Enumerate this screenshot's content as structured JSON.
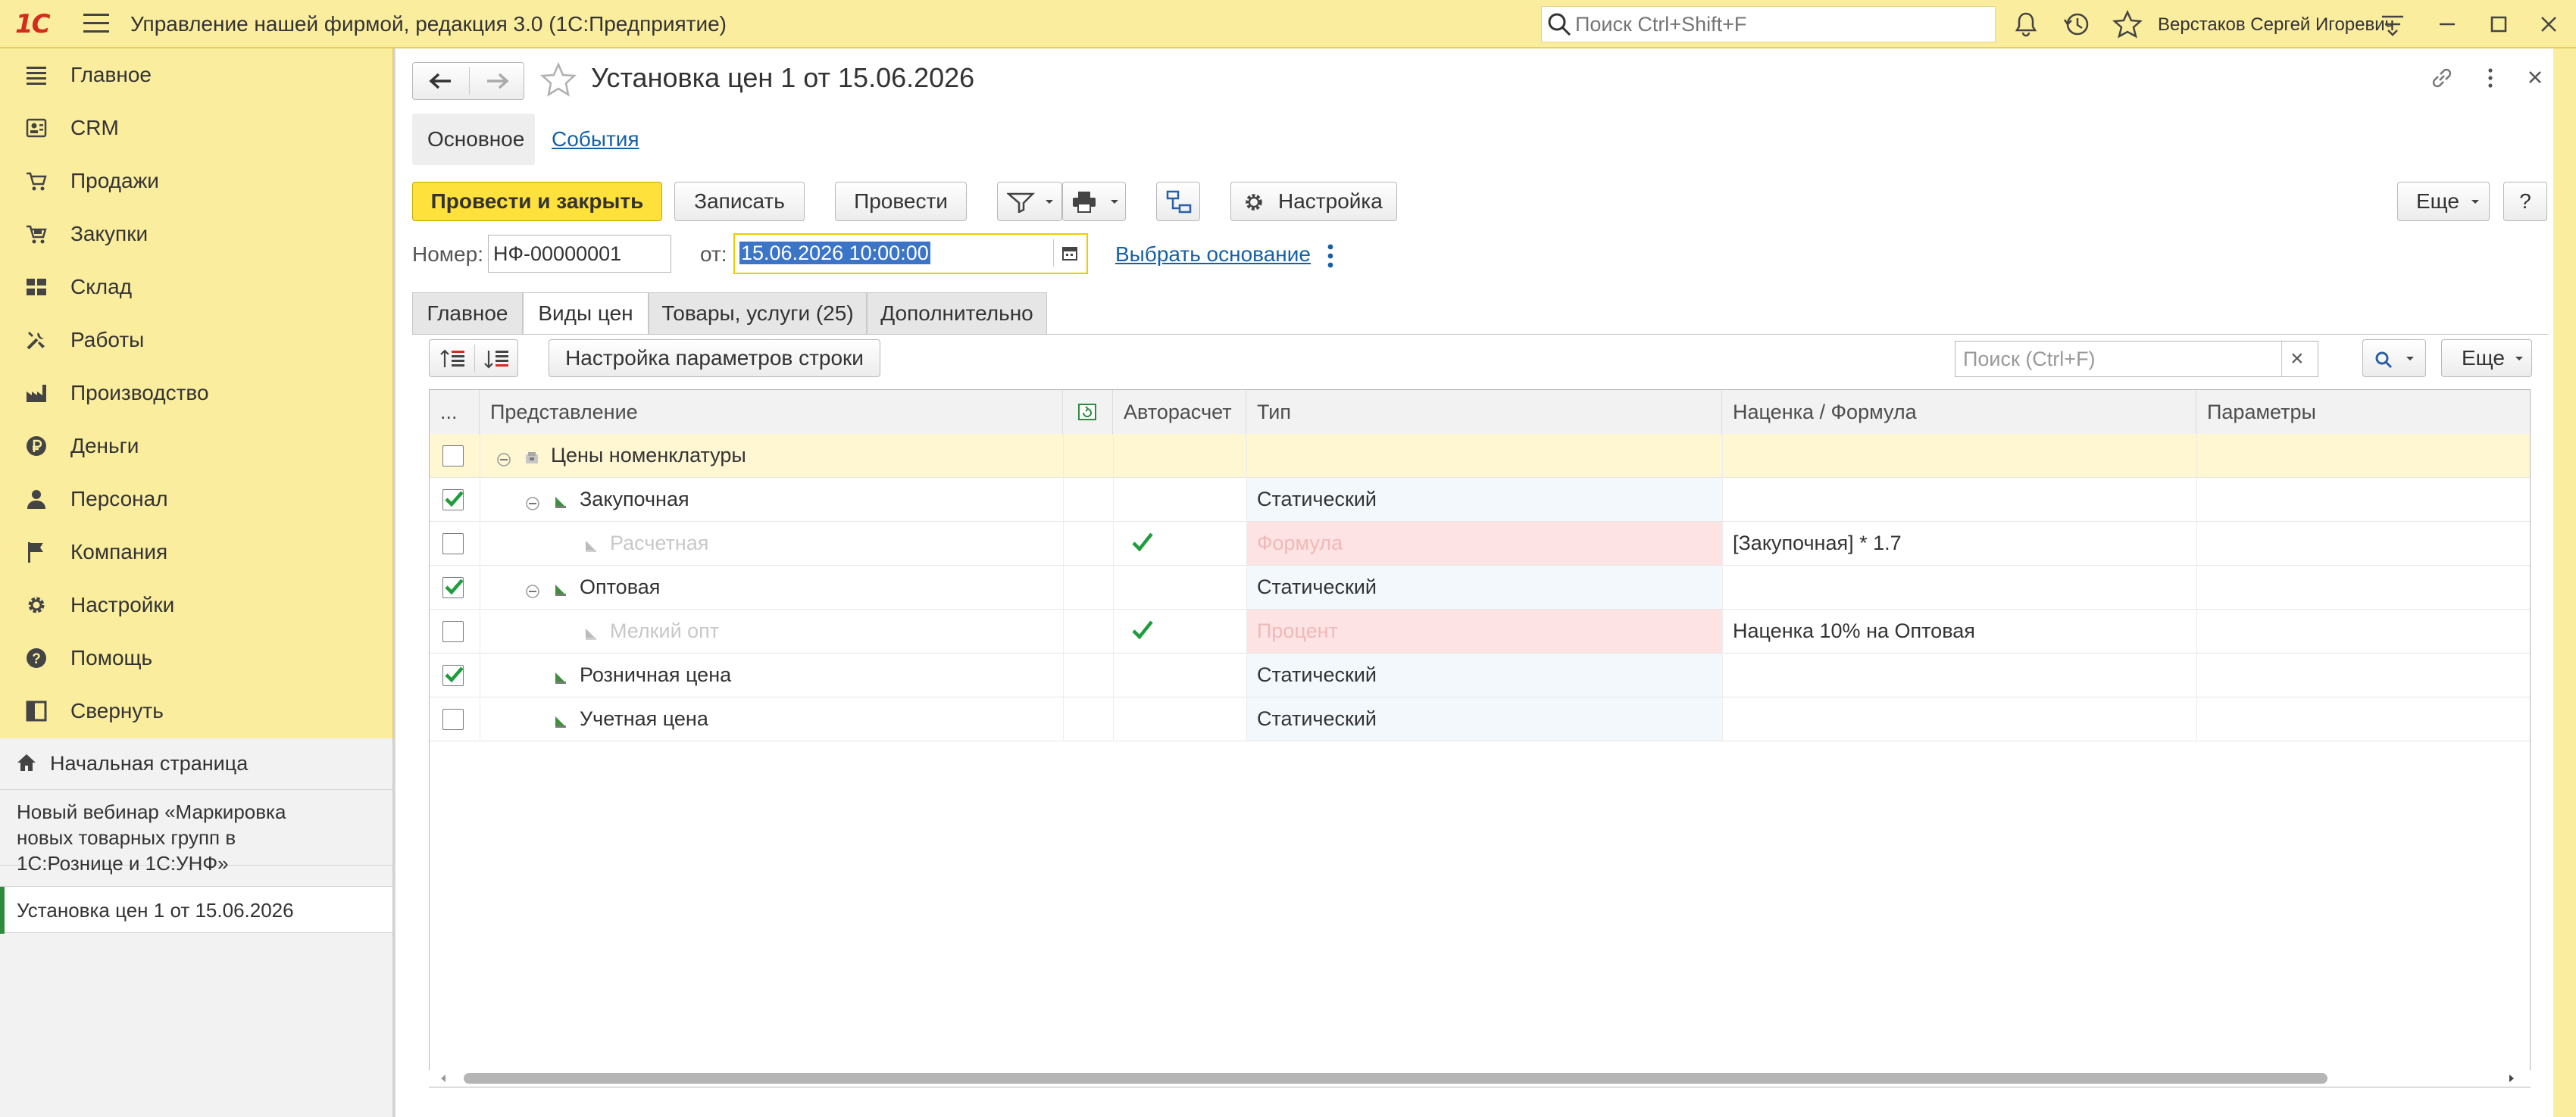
{
  "app": {
    "logo": "1С",
    "title": "Управление нашей фирмой, редакция 3.0  (1С:Предприятие)",
    "search_placeholder": "Поиск Ctrl+Shift+F",
    "user": "Верстаков Сергей Игоревич"
  },
  "sidebar": {
    "items": [
      {
        "label": "Главное",
        "icon": "menu-lines-icon"
      },
      {
        "label": "CRM",
        "icon": "contacts-icon"
      },
      {
        "label": "Продажи",
        "icon": "sales-cart-icon"
      },
      {
        "label": "Закупки",
        "icon": "purchases-icon"
      },
      {
        "label": "Склад",
        "icon": "warehouse-grid-icon"
      },
      {
        "label": "Работы",
        "icon": "tools-icon"
      },
      {
        "label": "Производство",
        "icon": "factory-icon"
      },
      {
        "label": "Деньги",
        "icon": "ruble-icon"
      },
      {
        "label": "Персонал",
        "icon": "person-icon"
      },
      {
        "label": "Компания",
        "icon": "flag-icon"
      },
      {
        "label": "Настройки",
        "icon": "gear-icon"
      },
      {
        "label": "Помощь",
        "icon": "help-icon"
      },
      {
        "label": "Свернуть",
        "icon": "collapse-panel-icon"
      }
    ],
    "home": "Начальная страница",
    "webinar": [
      "Новый вебинар «Маркировка",
      "новых товарных групп в",
      "1С:Рознице и 1С:УНФ»"
    ],
    "current_doc": "Установка цен 1 от 15.06.2026"
  },
  "document": {
    "title": "Установка цен 1 от 15.06.2026",
    "nav_tabs": {
      "main": "Основное",
      "events": "События"
    },
    "toolbar": {
      "post_close": "Провести и закрыть",
      "save": "Записать",
      "post": "Провести",
      "settings": "Настройка",
      "more": "Еще",
      "help": "?"
    },
    "number_label": "Номер:",
    "number_value": "НФ-00000001",
    "date_label": "от:",
    "date_value": "15.06.2026 10:00:00",
    "select_basis": "Выбрать основание",
    "tabs": [
      "Главное",
      "Виды цен",
      "Товары, услуги (25)",
      "Дополнительно"
    ],
    "table_toolbar": {
      "row_settings": "Настройка параметров строки",
      "search_placeholder": "Поиск (Ctrl+F)",
      "clear": "×",
      "more": "Еще"
    }
  },
  "table": {
    "columns": {
      "mark": "...",
      "name": "Представление",
      "auto": "Авторасчет",
      "type": "Тип",
      "markup": "Наценка / Формула",
      "params": "Параметры"
    },
    "rows": [
      {
        "checked": false,
        "name": "Цены номенклатуры",
        "auto": false,
        "type": "",
        "markup": "",
        "level": 0,
        "group": true,
        "muted": false,
        "highlight": "none"
      },
      {
        "checked": true,
        "name": "Закупочная",
        "auto": false,
        "type": "Статический",
        "markup": "",
        "level": 1,
        "group": false,
        "muted": false,
        "highlight": "blue"
      },
      {
        "checked": false,
        "name": "Расчетная",
        "auto": true,
        "type": "Формула",
        "markup": "[Закупочная] * 1.7",
        "level": 2,
        "group": false,
        "muted": true,
        "highlight": "red"
      },
      {
        "checked": true,
        "name": "Оптовая",
        "auto": false,
        "type": "Статический",
        "markup": "",
        "level": 1,
        "group": false,
        "muted": false,
        "highlight": "blue"
      },
      {
        "checked": false,
        "name": "Мелкий опт",
        "auto": true,
        "type": "Процент",
        "markup": "Наценка 10% на Оптовая",
        "level": 2,
        "group": false,
        "muted": true,
        "highlight": "red"
      },
      {
        "checked": true,
        "name": "Розничная цена",
        "auto": false,
        "type": "Статический",
        "markup": "",
        "level": 1,
        "group": false,
        "muted": false,
        "highlight": "blue"
      },
      {
        "checked": false,
        "name": "Учетная цена",
        "auto": false,
        "type": "Статический",
        "markup": "",
        "level": 1,
        "group": false,
        "muted": false,
        "highlight": "blue"
      }
    ]
  },
  "colors": {
    "accent_yellow": "#fee13b",
    "panel_yellow": "#fbed9e",
    "check_green": "#1f9c3b",
    "link_blue": "#1561a9",
    "row_red": "#fde3e3",
    "row_blue": "#f3f8fd",
    "row_group": "#fff6d2"
  }
}
